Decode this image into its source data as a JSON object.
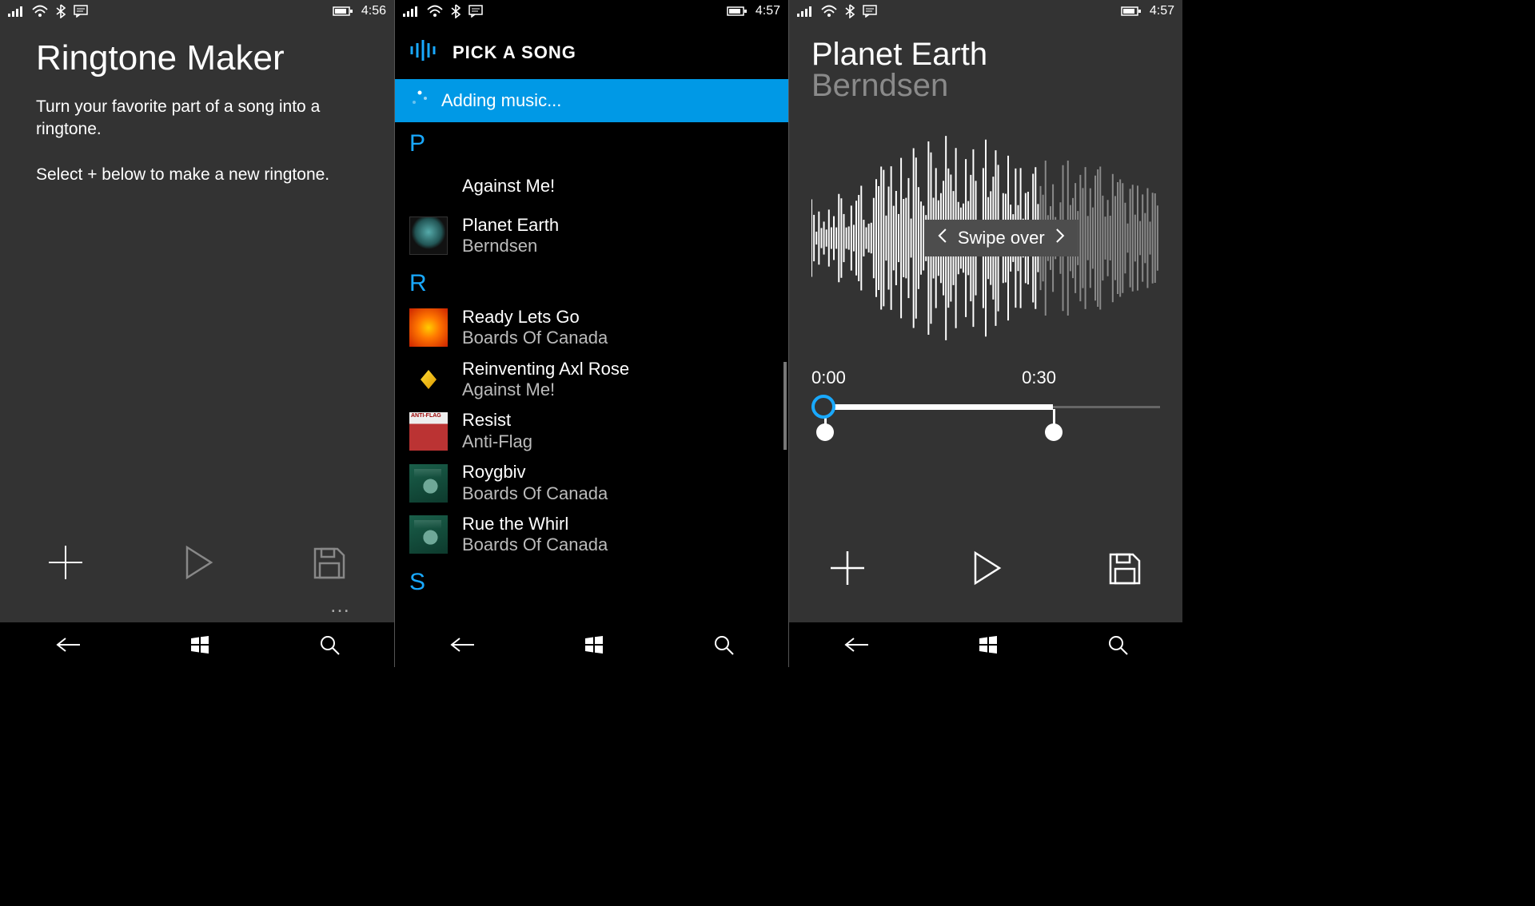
{
  "status": {
    "times": [
      "4:56",
      "4:57",
      "4:57"
    ]
  },
  "screen1": {
    "title": "Ringtone Maker",
    "line1": "Turn your favorite part of a song into a ringtone.",
    "line2": "Select + below to make a new ringtone.",
    "more": "…"
  },
  "screen2": {
    "header": "PICK A SONG",
    "banner": "Adding music...",
    "groups": [
      {
        "letter": "P",
        "songs": [
          {
            "title": "Against Me!",
            "artist": "",
            "art": "empty"
          },
          {
            "title": "Planet Earth",
            "artist": "Berndsen",
            "art": "planet"
          }
        ]
      },
      {
        "letter": "R",
        "songs": [
          {
            "title": "Ready Lets Go",
            "artist": "Boards Of Canada",
            "art": "ready"
          },
          {
            "title": "Reinventing Axl Rose",
            "artist": "Against Me!",
            "art": "axl"
          },
          {
            "title": "Resist",
            "artist": "Anti-Flag",
            "art": "resist"
          },
          {
            "title": "Roygbiv",
            "artist": "Boards Of Canada",
            "art": "boc"
          },
          {
            "title": "Rue the Whirl",
            "artist": "Boards Of Canada",
            "art": "boc"
          }
        ]
      },
      {
        "letter": "S",
        "songs": []
      }
    ]
  },
  "screen3": {
    "title": "Planet Earth",
    "artist": "Berndsen",
    "swipe": "Swipe over",
    "start": "0:00",
    "end": "0:30"
  },
  "icons": {
    "add": "add",
    "play": "play",
    "save": "save",
    "back": "back",
    "windows": "windows",
    "search": "search"
  }
}
